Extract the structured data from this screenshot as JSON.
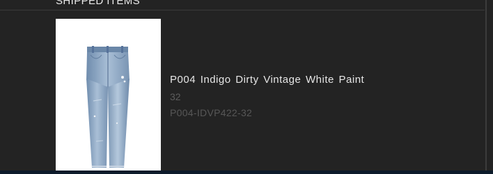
{
  "section": {
    "title": "SHIPPED ITEMS"
  },
  "items": [
    {
      "name": "P004 Indigo Dirty Vintage White Paint",
      "size": "32",
      "sku": "P004-IDVP422-32",
      "image_icon": "jeans-product-photo"
    }
  ],
  "colors": {
    "background": "#232323",
    "text_primary": "#e6e6e6",
    "text_muted": "#5c5c5c",
    "bottom_bar": "#0d1b2b"
  }
}
